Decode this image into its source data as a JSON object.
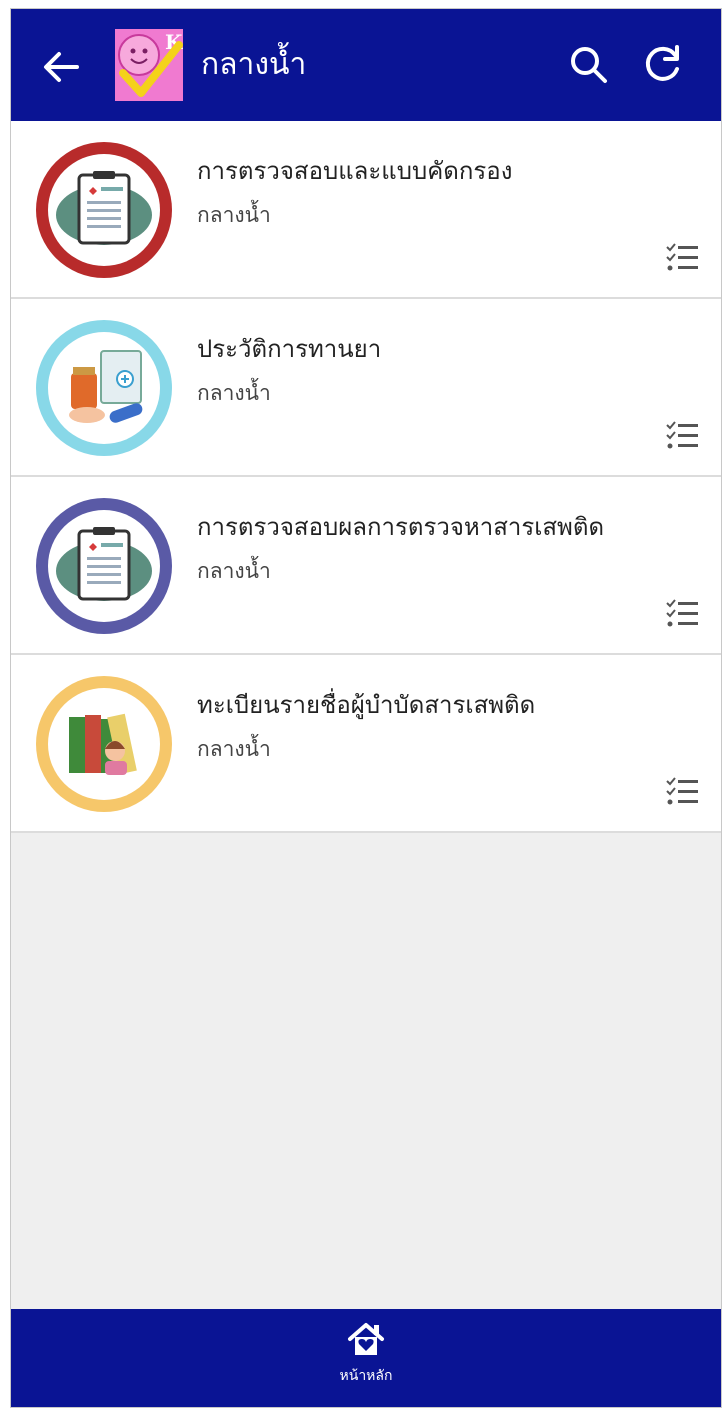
{
  "header": {
    "title": "กลางน้ำ",
    "background": "#0a1494"
  },
  "items": [
    {
      "title": "การตรวจสอบและแบบคัดกรอง",
      "subtitle": "กลางน้ำ",
      "icon": "clipboard-health-record-icon",
      "ring_color": "#b82b2b"
    },
    {
      "title": "ประวัติการทานยา",
      "subtitle": "กลางน้ำ",
      "icon": "medicine-prescription-icon",
      "ring_color": "#88d8e8"
    },
    {
      "title": "การตรวจสอบผลการตรวจหาสารเสพติด",
      "subtitle": "กลางน้ำ",
      "icon": "clipboard-health-record-icon",
      "ring_color": "#5a5aa6"
    },
    {
      "title": "ทะเบียนรายชื่อผู้บำบัดสารเสพติด",
      "subtitle": "กลางน้ำ",
      "icon": "registry-books-person-icon",
      "ring_color": "#f6c76a"
    }
  ],
  "bottom_nav": {
    "home_label": "หน้าหลัก",
    "home_icon": "home-heart-icon"
  }
}
